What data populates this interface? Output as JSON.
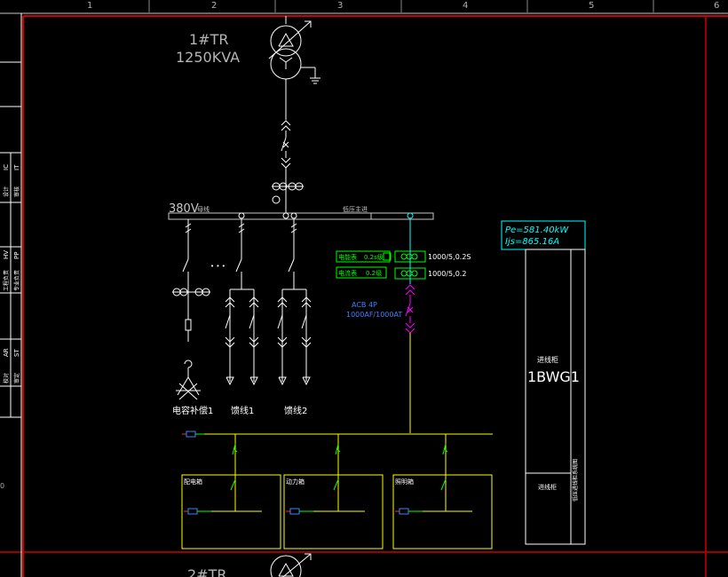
{
  "ruler": {
    "columns": [
      "1",
      "2",
      "3",
      "4",
      "5",
      "6"
    ]
  },
  "left_strip": {
    "row_labels": [
      "IC",
      "IT",
      "HV",
      "PP",
      "AR",
      "ST"
    ],
    "row_labels_cn": [
      "设计",
      "审核",
      "工程负责",
      "专业负责",
      "校对",
      "审定"
    ],
    "edge_mark": "0"
  },
  "transformer_top": {
    "name": "1#TR",
    "rating": "1250KVA"
  },
  "transformer_bottom": {
    "name": "2#TR"
  },
  "busbar": {
    "label": "380V",
    "sub_label": "母线",
    "sub_label_right": "低压主进"
  },
  "meters": {
    "energy_meter": "电能表",
    "energy_class": "0.2s级",
    "ammeter": "电流表",
    "ammeter_class": "0.2级",
    "ct_upper": "1000/5,0.2S",
    "ct_lower": "1000/5,0.2"
  },
  "breaker": {
    "type": "ACB 4P",
    "rating": "1000AF/1000AT"
  },
  "feeder_labels": [
    "电容补偿1",
    "馈线1",
    "馈线2"
  ],
  "ellipsis": "• • •",
  "panel": {
    "pe": "Pe=581.40kW",
    "ijs": "Ijs=865.16A",
    "cabinet_type": "进线柜",
    "cabinet_id": "1BWG1",
    "bottom_label": "进线柜",
    "side_text": "低压进线柜系统图"
  },
  "sub_boxes": [
    {
      "title": "配电箱"
    },
    {
      "title": "动力箱"
    },
    {
      "title": "照明箱"
    }
  ],
  "colors": {
    "frame": "#cc0000",
    "strip": "#ffffff",
    "busbar": "#c8c8c8",
    "wire": "#ffffff",
    "green": "#00ff00",
    "magenta": "#ff00ff",
    "yellow": "#ffff00",
    "cyan": "#00ffff",
    "red": "#ff3030",
    "blue": "#4080ff"
  }
}
